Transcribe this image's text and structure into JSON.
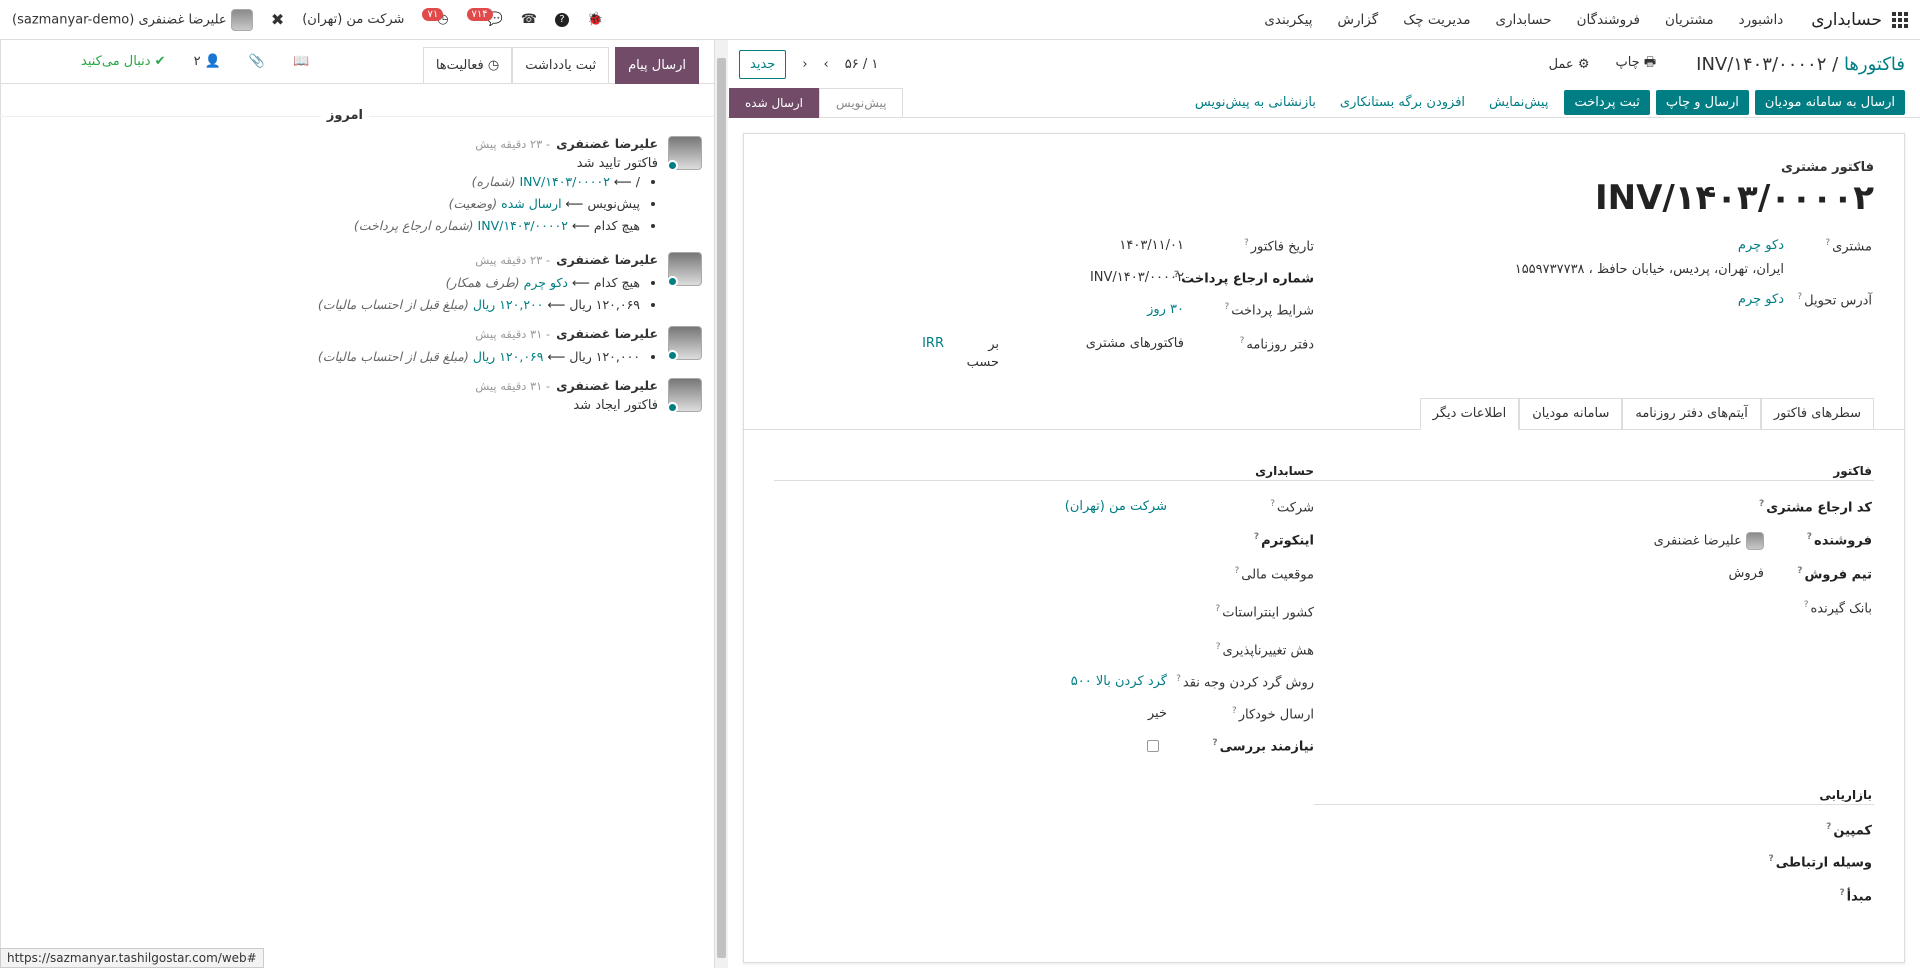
{
  "navbar": {
    "app_name": "حسابداری",
    "menu": [
      "داشبورد",
      "مشتریان",
      "فروشندگان",
      "حسابداری",
      "مدیریت چک",
      "گزارش",
      "پیکربندی"
    ],
    "user": "علیرضا غضنفری (sazmanyar-demo)",
    "company": "شرکت من (تهران)",
    "badge_activity": "۷۱",
    "badge_messages": "۷۱۴"
  },
  "control": {
    "breadcrumb_parent": "فاکتورها",
    "breadcrumb_sep": "/",
    "breadcrumb_current": "INV/۱۴۰۳/۰۰۰۰۲",
    "print": "چاپ",
    "action": "عمل",
    "pager": "۱ / ۵۶",
    "new": "جدید"
  },
  "statusbar": {
    "buttons_primary": [
      "ارسال به سامانه مودیان",
      "ارسال و چاپ",
      "ثبت پرداخت"
    ],
    "buttons_link": [
      "پیش‌نمایش",
      "افزودن برگه بستانکاری",
      "بازنشانی به پیش‌نویس"
    ],
    "status_posted": "ارسال شده",
    "status_draft": "پیش‌نویس"
  },
  "sheet": {
    "type": "فاکتور مشتری",
    "name": "INV/۱۴۰۳/۰۰۰۰۲",
    "customer_label": "مشتری",
    "customer_value": "دکو چرم",
    "customer_address": "ایران، تهران، پردیس، خیابان حافظ ، ۱۵۵۹۷۳۷۷۳۸",
    "delivery_label": "آدرس تحویل",
    "delivery_value": "دکو چرم",
    "invoice_date_label": "تاریخ فاکتور",
    "invoice_date_value": "۱۴۰۳/۱۱/۰۱",
    "payment_ref_label": "شماره ارجاع پرداخت",
    "payment_ref_value": "INV/۱۴۰۳/۰۰۰۰۲",
    "payment_terms_label": "شرایط پرداخت",
    "payment_terms_value": "۳۰ روز",
    "journal_label": "دفتر روزنامه",
    "journal_value": "فاکتورهای مشتری",
    "journal_in": "بر حسب",
    "journal_currency": "IRR"
  },
  "tabs": [
    "سطرهای فاکتور",
    "آیتم‌های دفتر روزنامه",
    "سامانه مودیان",
    "اطلاعات دیگر"
  ],
  "other_info": {
    "invoice_section": "فاکتور",
    "customer_ref_label": "کد ارجاع مشتری",
    "salesperson_label": "فروشنده",
    "salesperson_value": "علیرضا غضنفری",
    "sales_team_label": "تیم فروش",
    "sales_team_value": "فروش",
    "recipient_bank_label": "بانک گیرنده",
    "marketing_section": "بازاریابی",
    "campaign_label": "کمپین",
    "medium_label": "وسیله ارتباطی",
    "source_label": "مبدأ",
    "accounting_section": "حسابداری",
    "company_label": "شرکت",
    "company_value": "شرکت من (تهران)",
    "incoterm_label": "اینکوترم",
    "fiscal_pos_label": "موقعیت مالی",
    "intrastat_label": "کشور اینتراستات",
    "hash_label": "هش تغییرناپذیری",
    "rounding_label": "روش گرد کردن وجه نقد",
    "rounding_value": "گرد کردن بالا ۵۰۰",
    "auto_send_label": "ارسال خودکار",
    "auto_send_value": "خیر",
    "to_check_label": "نیازمند بررسی"
  },
  "chatter": {
    "send_message": "ارسال پیام",
    "log_note": "ثبت یادداشت",
    "activities": "فعالیت‌ها",
    "followers_count": "۲",
    "following": "دنبال می‌کنید",
    "today": "امروز",
    "messages": [
      {
        "author": "علیرضا غضنفری",
        "time": "- ۲۳ دقیقه پیش",
        "body": "فاکتور تایید شد",
        "changes": [
          {
            "old": "/",
            "new": "INV/۱۴۰۳/۰۰۰۰۲",
            "field": "(شماره)"
          },
          {
            "old": "پیش‌نویس",
            "new": "ارسال شده",
            "field": "(وضعیت)"
          },
          {
            "old": "هیچ کدام",
            "new": "INV/۱۴۰۳/۰۰۰۰۲",
            "field": "(شماره ارجاع پرداخت)"
          }
        ]
      },
      {
        "author": "علیرضا غضنفری",
        "time": "- ۲۳ دقیقه پیش",
        "changes": [
          {
            "old": "هیچ کدام",
            "new": "دکو چرم",
            "field": "(طرف همکار)"
          },
          {
            "old": "۱۲۰,۰۶۹ ریال",
            "new": "۱۲۰,۲۰۰ ریال",
            "field": "(مبلغ قبل از احتساب مالیات)"
          }
        ]
      },
      {
        "author": "علیرضا غضنفری",
        "time": "- ۳۱ دقیقه پیش",
        "changes": [
          {
            "old": "۱۲۰,۰۰۰ ریال",
            "new": "۱۲۰,۰۶۹ ریال",
            "field": "(مبلغ قبل از احتساب مالیات)"
          }
        ]
      },
      {
        "author": "علیرضا غضنفری",
        "time": "- ۳۱ دقیقه پیش",
        "body": "فاکتور ایجاد شد"
      }
    ]
  },
  "url_tooltip": "https://sazmanyar.tashilgostar.com/web#"
}
